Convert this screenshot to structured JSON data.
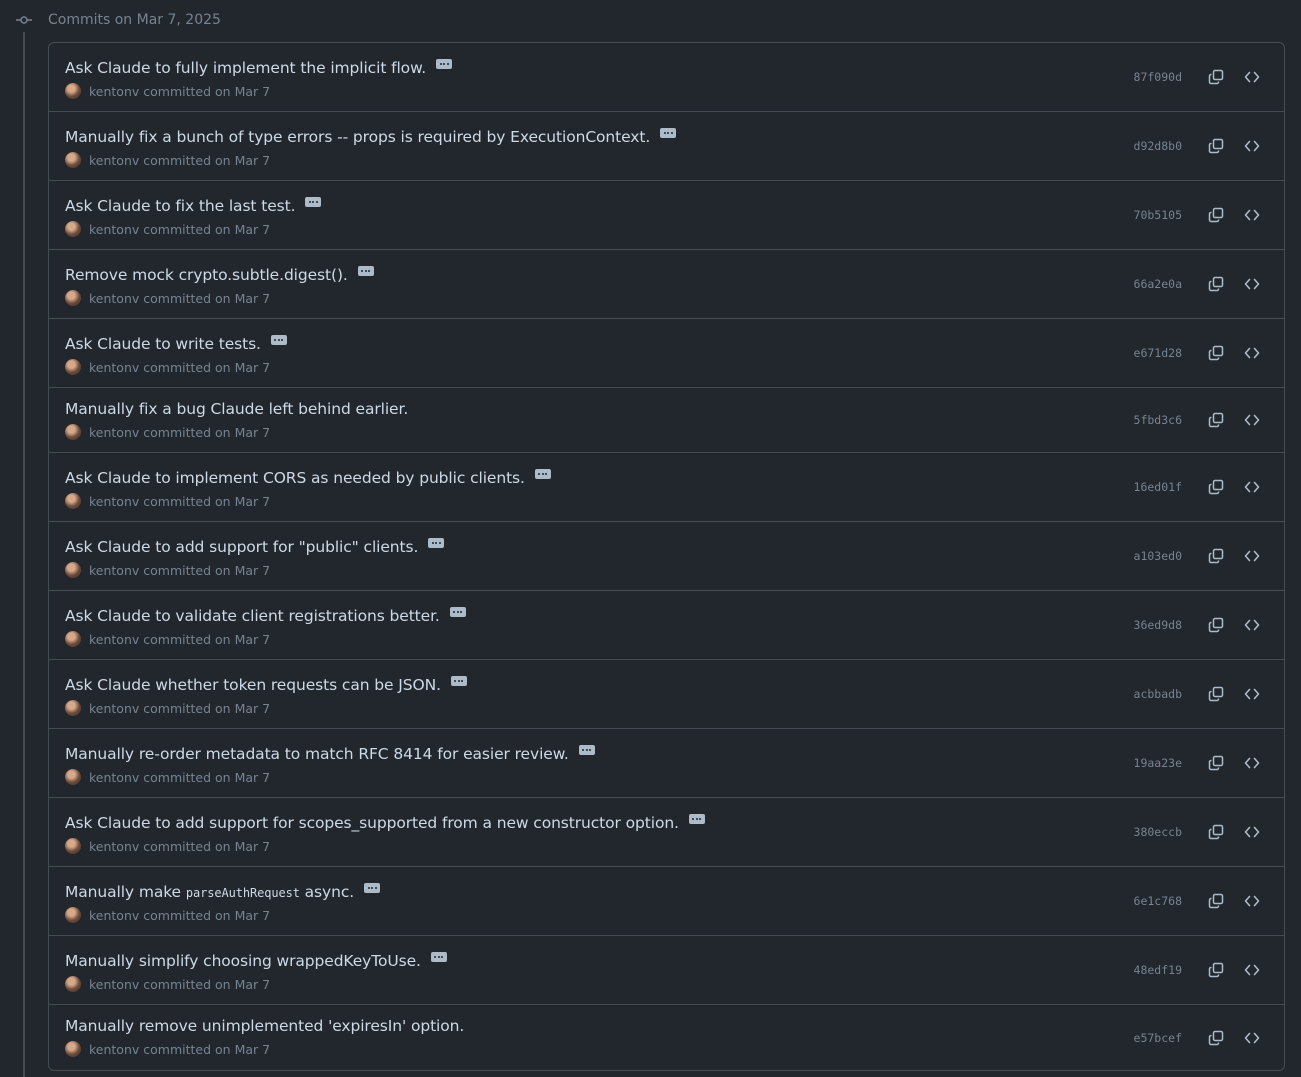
{
  "header": {
    "date_label": "Commits on Mar 7, 2025"
  },
  "commits": [
    {
      "title": "Ask Claude to fully implement the implicit flow.",
      "has_ellipsis": true,
      "author": "kentonv",
      "date_text": "committed on Mar 7",
      "sha": "87f090d"
    },
    {
      "title": "Manually fix a bunch of type errors -- props is required by ExecutionContext.",
      "has_ellipsis": true,
      "author": "kentonv",
      "date_text": "committed on Mar 7",
      "sha": "d92d8b0"
    },
    {
      "title": "Ask Claude to fix the last test.",
      "has_ellipsis": true,
      "author": "kentonv",
      "date_text": "committed on Mar 7",
      "sha": "70b5105"
    },
    {
      "title": "Remove mock crypto.subtle.digest().",
      "has_ellipsis": true,
      "author": "kentonv",
      "date_text": "committed on Mar 7",
      "sha": "66a2e0a"
    },
    {
      "title": "Ask Claude to write tests.",
      "has_ellipsis": true,
      "author": "kentonv",
      "date_text": "committed on Mar 7",
      "sha": "e671d28"
    },
    {
      "title": "Manually fix a bug Claude left behind earlier.",
      "has_ellipsis": false,
      "author": "kentonv",
      "date_text": "committed on Mar 7",
      "sha": "5fbd3c6"
    },
    {
      "title": "Ask Claude to implement CORS as needed by public clients.",
      "has_ellipsis": true,
      "author": "kentonv",
      "date_text": "committed on Mar 7",
      "sha": "16ed01f"
    },
    {
      "title": "Ask Claude to add support for \"public\" clients.",
      "has_ellipsis": true,
      "author": "kentonv",
      "date_text": "committed on Mar 7",
      "sha": "a103ed0"
    },
    {
      "title": "Ask Claude to validate client registrations better.",
      "has_ellipsis": true,
      "author": "kentonv",
      "date_text": "committed on Mar 7",
      "sha": "36ed9d8"
    },
    {
      "title": "Ask Claude whether token requests can be JSON.",
      "has_ellipsis": true,
      "author": "kentonv",
      "date_text": "committed on Mar 7",
      "sha": "acbbadb"
    },
    {
      "title": "Manually re-order metadata to match RFC 8414 for easier review.",
      "has_ellipsis": true,
      "author": "kentonv",
      "date_text": "committed on Mar 7",
      "sha": "19aa23e"
    },
    {
      "title": "Ask Claude to add support for scopes_supported from a new constructor option.",
      "has_ellipsis": true,
      "author": "kentonv",
      "date_text": "committed on Mar 7",
      "sha": "380eccb"
    },
    {
      "title_prefix": "Manually make ",
      "title_code": "parseAuthRequest",
      "title_suffix": " async.",
      "has_ellipsis": true,
      "author": "kentonv",
      "date_text": "committed on Mar 7",
      "sha": "6e1c768"
    },
    {
      "title": "Manually simplify choosing wrappedKeyToUse.",
      "has_ellipsis": true,
      "author": "kentonv",
      "date_text": "committed on Mar 7",
      "sha": "48edf19"
    },
    {
      "title": "Manually remove unimplemented 'expiresIn' option.",
      "has_ellipsis": false,
      "author": "kentonv",
      "date_text": "committed on Mar 7",
      "sha": "e57bcef"
    }
  ],
  "icons": {
    "commit": "git-commit-icon",
    "avatar": "user-avatar",
    "ellipsis": "kebab-horizontal-icon",
    "copy": "copy-icon",
    "browse": "code-icon"
  },
  "colors": {
    "background": "#22272e",
    "border": "#444c56",
    "title": "#cdd9e5",
    "muted": "#768390"
  }
}
